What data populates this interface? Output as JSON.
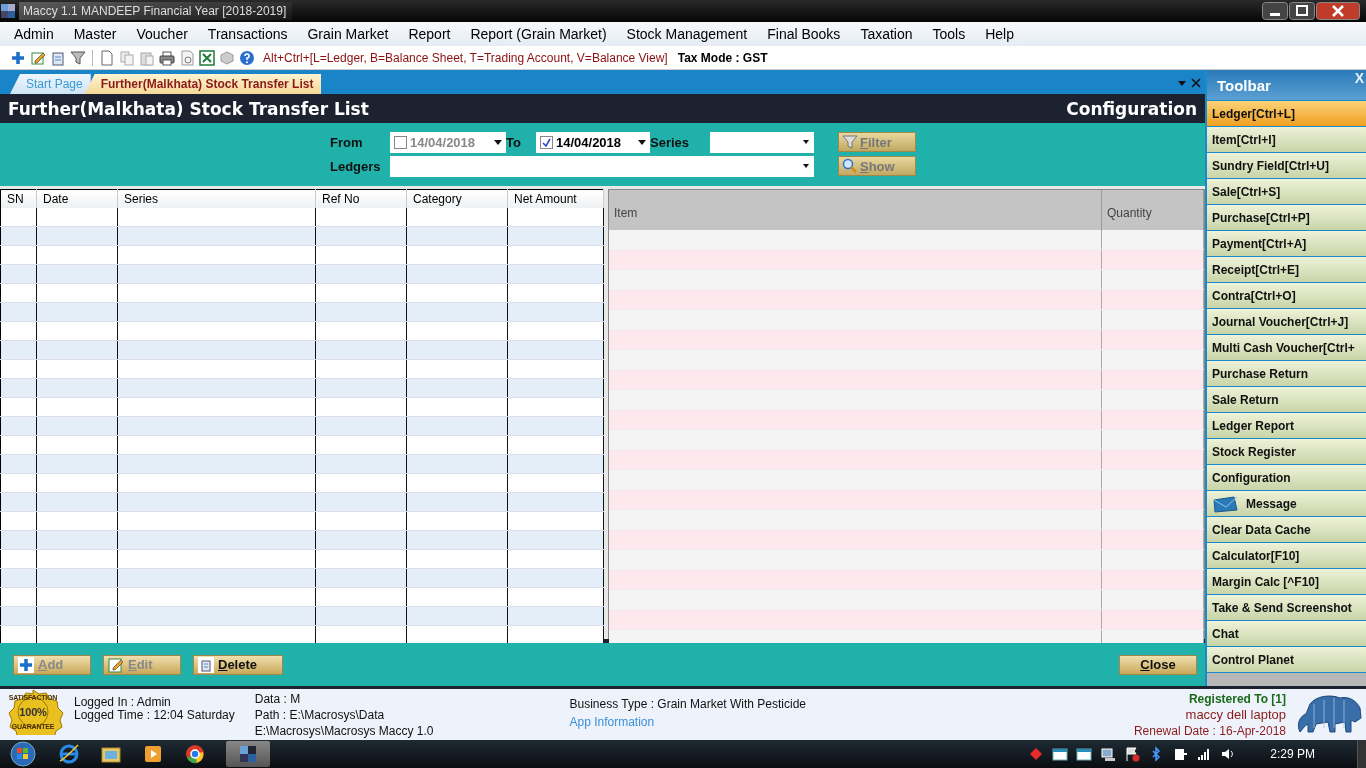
{
  "window": {
    "title": "Maccy 1.1 MANDEEP Financial Year [2018-2019]"
  },
  "menu": [
    "Admin",
    "Master",
    "Voucher",
    "Transactions",
    "Grain Market",
    "Report",
    "Report (Grain Market)",
    "Stock Management",
    "Final Books",
    "Taxation",
    "Tools",
    "Help"
  ],
  "toolbar": {
    "shortcut_hint": "Alt+Ctrl+[L=Ledger, B=Balance Sheet, T=Trading Account, V=Balance View]",
    "tax_mode": "Tax Mode : GST"
  },
  "tabs": [
    {
      "label": "Start Page",
      "selected": false
    },
    {
      "label": "Further(Malkhata) Stock Transfer List",
      "selected": true
    }
  ],
  "page": {
    "title": "Further(Malkhata) Stock Transfer List",
    "configuration": "Configuration"
  },
  "filters": {
    "from_label": "From",
    "from_date": {
      "value": "14/04/2018",
      "checked": false
    },
    "to_label": "To",
    "to_date": {
      "value": "14/04/2018",
      "checked": true
    },
    "series_label": "Series",
    "ledgers_label": "Ledgers",
    "buttons": [
      "Filter",
      "Show"
    ]
  },
  "transfer_table": {
    "columns": [
      "SN",
      "Date",
      "Series",
      "Ref No",
      "Category",
      "Net Amount"
    ]
  },
  "items_table": {
    "columns": [
      "Item",
      "Quantity"
    ]
  },
  "actions": [
    {
      "label": "Add",
      "disabled": true
    },
    {
      "label": "Edit",
      "disabled": true
    },
    {
      "label": "Delete",
      "disabled": false
    }
  ],
  "close_button": "Close",
  "sidebar": {
    "title": "Toolbar",
    "close": "X",
    "items": [
      {
        "label": "Ledger[Ctrl+L]",
        "selected": true,
        "kind": "text"
      },
      {
        "label": "Item[Ctrl+I]",
        "selected": false,
        "kind": "text"
      },
      {
        "label": "Sundry Field[Ctrl+U]",
        "selected": false,
        "kind": "text"
      },
      {
        "label": "Sale[Ctrl+S]",
        "selected": false,
        "kind": "text"
      },
      {
        "label": "Purchase[Ctrl+P]",
        "selected": false,
        "kind": "text"
      },
      {
        "label": "Payment[Ctrl+A]",
        "selected": false,
        "kind": "text"
      },
      {
        "label": "Receipt[Ctrl+E]",
        "selected": false,
        "kind": "text"
      },
      {
        "label": "Contra[Ctrl+O]",
        "selected": false,
        "kind": "text"
      },
      {
        "label": "Journal Voucher[Ctrl+J]",
        "selected": false,
        "kind": "text"
      },
      {
        "label": "Multi Cash Voucher[Ctrl+",
        "selected": false,
        "kind": "text"
      },
      {
        "label": "Purchase Return",
        "selected": false,
        "kind": "text"
      },
      {
        "label": "Sale Return",
        "selected": false,
        "kind": "text"
      },
      {
        "label": "Ledger Report",
        "selected": false,
        "kind": "text"
      },
      {
        "label": "Stock Register",
        "selected": false,
        "kind": "text"
      },
      {
        "label": "Configuration",
        "selected": false,
        "kind": "text"
      },
      {
        "label": "Message",
        "selected": false,
        "kind": "message"
      },
      {
        "label": "Clear Data Cache",
        "selected": false,
        "kind": "text"
      },
      {
        "label": "Calculator[F10]",
        "selected": false,
        "kind": "text"
      },
      {
        "label": "Margin Calc [^F10]",
        "selected": false,
        "kind": "text"
      },
      {
        "label": "Take & Send Screenshot",
        "selected": false,
        "kind": "text"
      },
      {
        "label": "Chat",
        "selected": false,
        "kind": "text"
      },
      {
        "label": "Control Planet",
        "selected": false,
        "kind": "text"
      }
    ]
  },
  "status": {
    "badge": [
      "SATISFACTION",
      "100%",
      "GUARANTEE"
    ],
    "logged_in": "Logged In : Admin",
    "logged_time": "Logged Time : 12:04 Saturday",
    "data": "Data : M",
    "path": "Path : E:\\Macrosys\\Data",
    "install_path": "E:\\Macrosys\\Macrosys Maccy 1.0",
    "business_type": "Business Type : Grain Market With Pesticide",
    "app_info": "App Information",
    "registered": "Registered To [1]",
    "registered_name": "maccy dell laptop",
    "renewal": "Renewal Date : 16-Apr-2018"
  },
  "taskbar": {
    "clock": "2:29 PM"
  }
}
